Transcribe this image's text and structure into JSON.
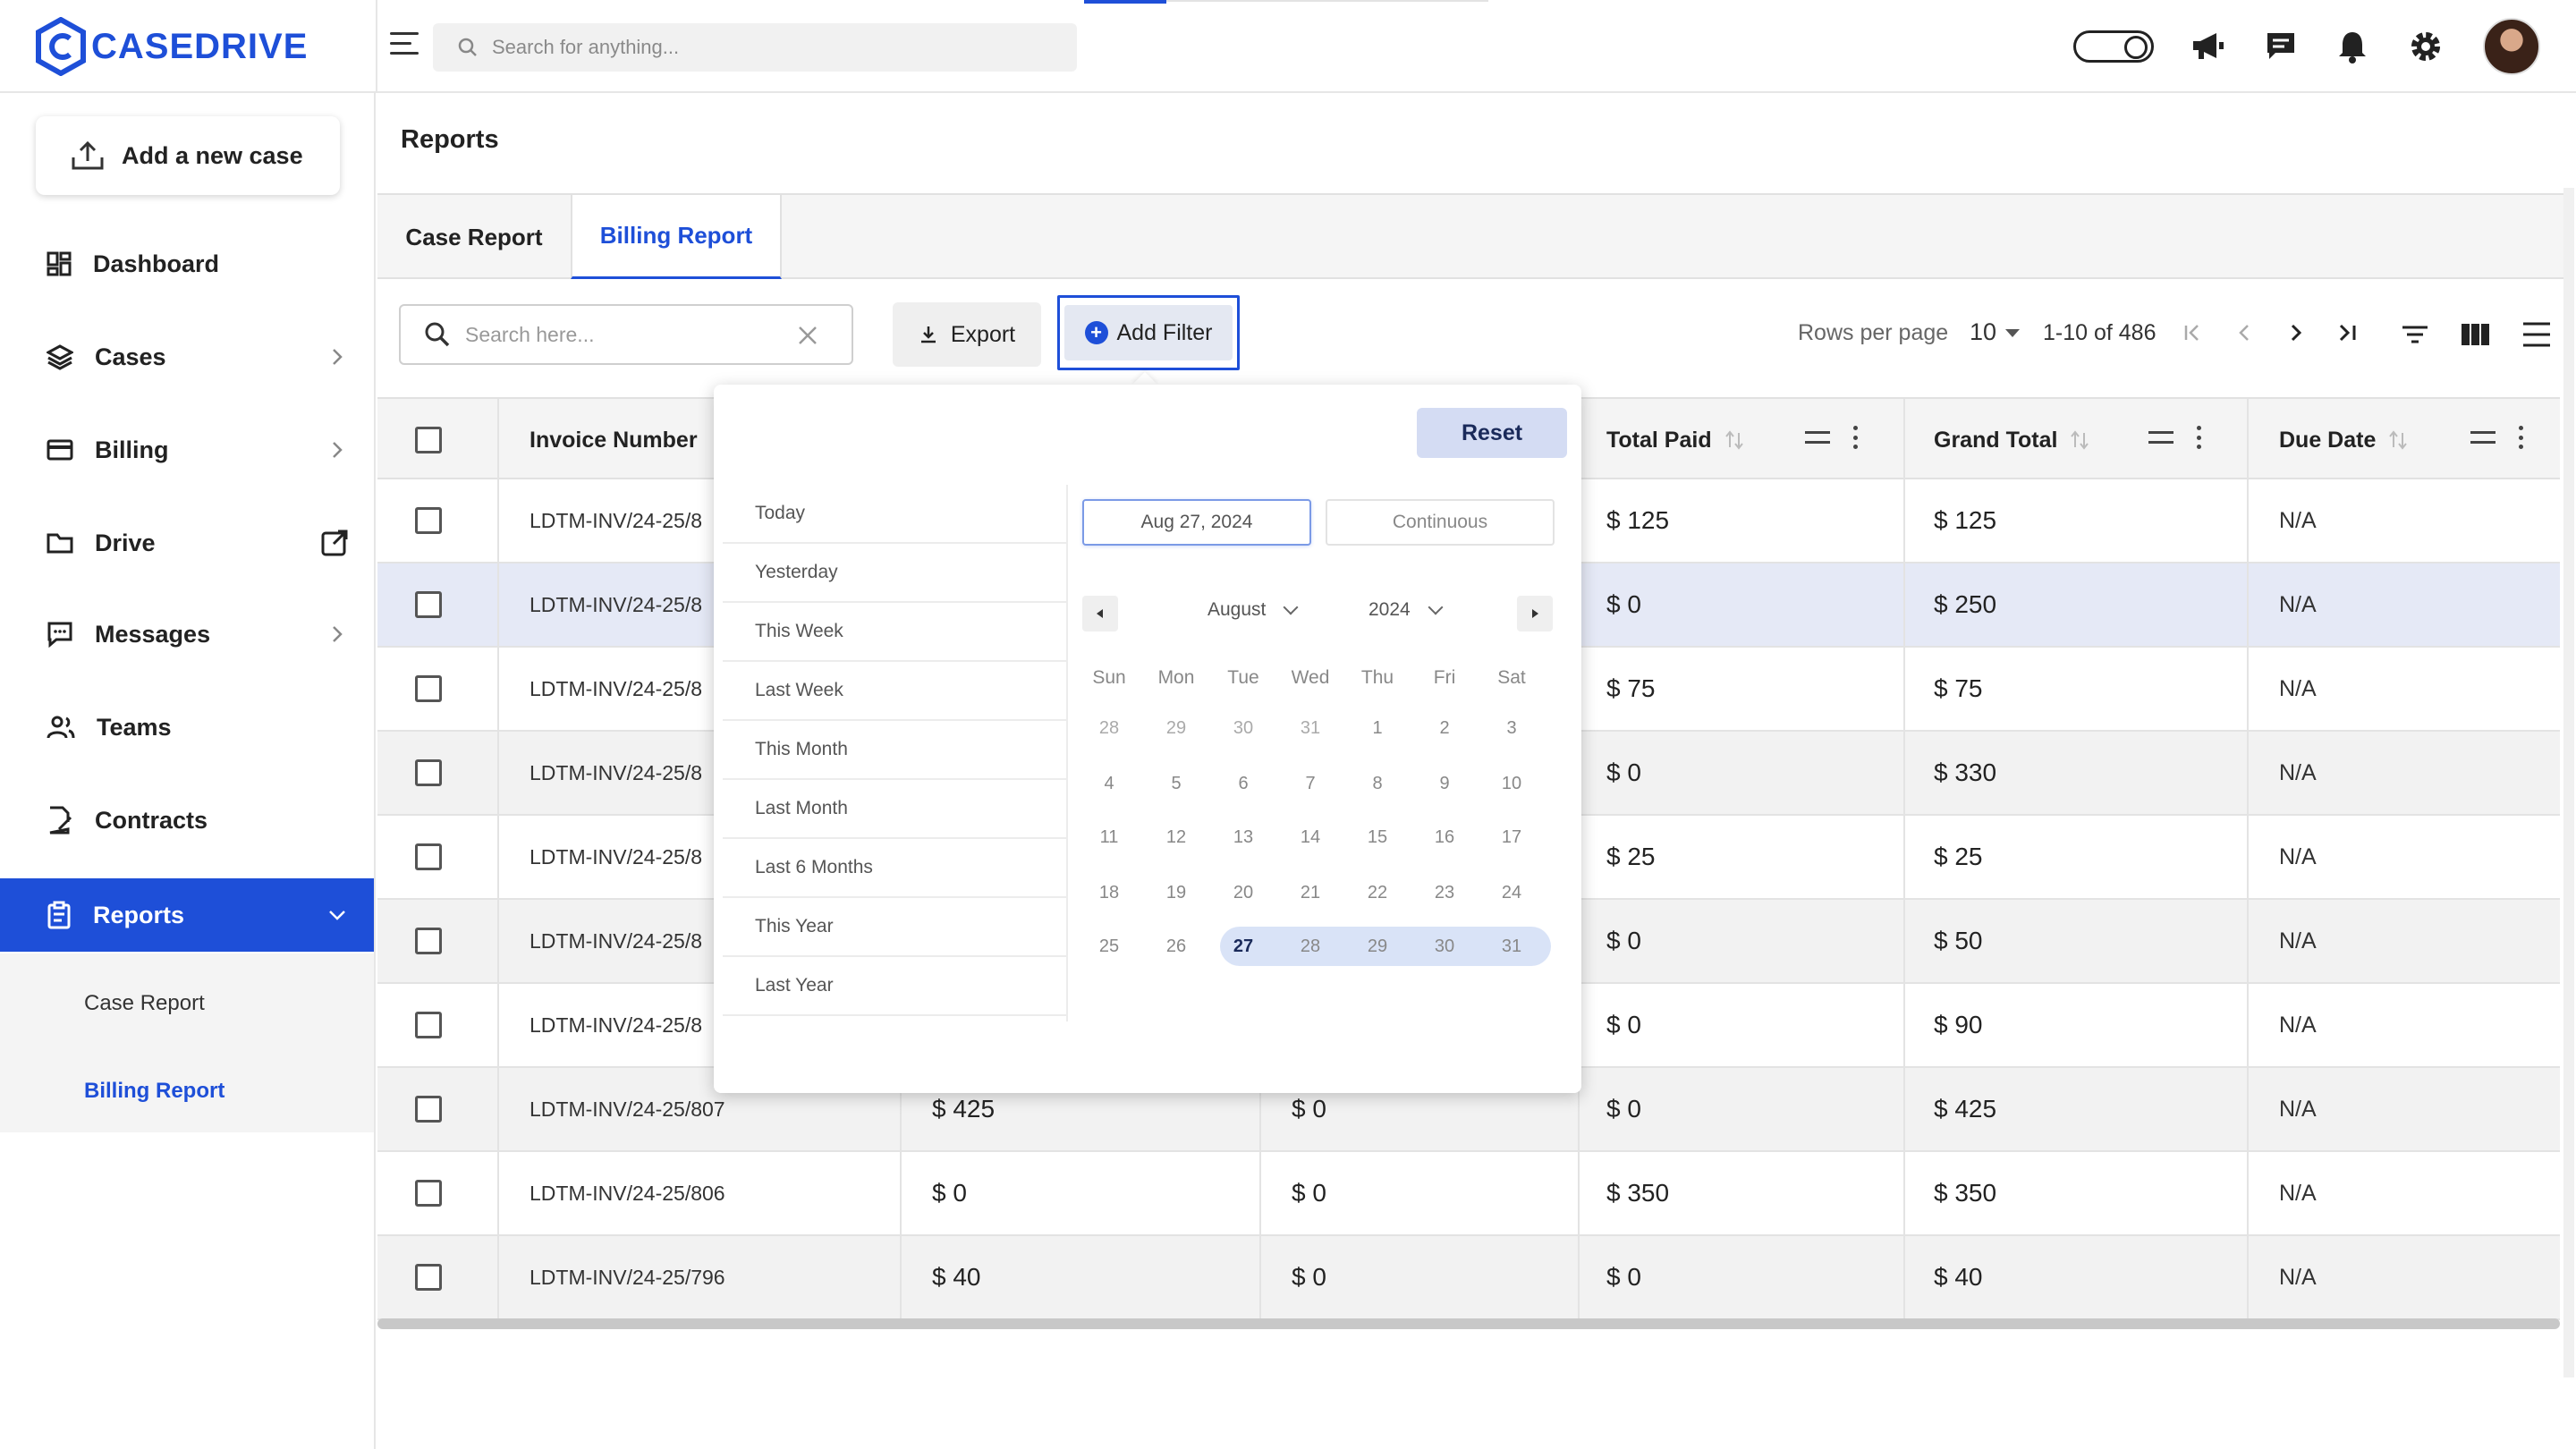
{
  "app": {
    "brand": "CASEDRIVE"
  },
  "header": {
    "search_placeholder": "Search for anything...",
    "icons": [
      "menu-icon",
      "search-icon",
      "theme-toggle",
      "megaphone-icon",
      "chat-icon",
      "bell-icon",
      "gear-icon",
      "avatar"
    ]
  },
  "sidebar": {
    "add_case_label": "Add a new case",
    "items": [
      {
        "label": "Dashboard",
        "icon": "dashboard-icon"
      },
      {
        "label": "Cases",
        "icon": "layers-icon"
      },
      {
        "label": "Billing",
        "icon": "card-icon"
      },
      {
        "label": "Drive",
        "icon": "folder-icon"
      },
      {
        "label": "Messages",
        "icon": "message-icon"
      },
      {
        "label": "Teams",
        "icon": "team-icon"
      },
      {
        "label": "Contracts",
        "icon": "contract-icon"
      },
      {
        "label": "Reports",
        "icon": "clipboard-icon"
      }
    ],
    "sub_items": [
      "Case Report",
      "Billing Report"
    ]
  },
  "page": {
    "title": "Reports",
    "tabs": [
      "Case Report",
      "Billing Report"
    ],
    "active_tab": "Billing Report"
  },
  "toolbar": {
    "search_placeholder": "Search here...",
    "export_label": "Export",
    "add_filter_label": "Add Filter",
    "rows_per_page_label": "Rows per page",
    "rows_per_page_value": "10",
    "range_text": "1-10 of 486"
  },
  "table": {
    "columns": [
      "Invoice Number",
      "Total Paid",
      "Grand Total",
      "Due Date"
    ],
    "rows": [
      {
        "invoice": "LDTM-INV/24-25/8",
        "c2": "",
        "c3": "",
        "paid": "$ 125",
        "grand": "$ 125",
        "due": "N/A"
      },
      {
        "invoice": "LDTM-INV/24-25/8",
        "c2": "",
        "c3": "",
        "paid": "$ 0",
        "grand": "$ 250",
        "due": "N/A"
      },
      {
        "invoice": "LDTM-INV/24-25/8",
        "c2": "",
        "c3": "",
        "paid": "$ 75",
        "grand": "$ 75",
        "due": "N/A"
      },
      {
        "invoice": "LDTM-INV/24-25/8",
        "c2": "",
        "c3": "",
        "paid": "$ 0",
        "grand": "$ 330",
        "due": "N/A"
      },
      {
        "invoice": "LDTM-INV/24-25/8",
        "c2": "",
        "c3": "",
        "paid": "$ 25",
        "grand": "$ 25",
        "due": "N/A"
      },
      {
        "invoice": "LDTM-INV/24-25/8",
        "c2": "",
        "c3": "",
        "paid": "$ 0",
        "grand": "$ 50",
        "due": "N/A"
      },
      {
        "invoice": "LDTM-INV/24-25/8",
        "c2": "",
        "c3": "",
        "paid": "$ 0",
        "grand": "$ 90",
        "due": "N/A"
      },
      {
        "invoice": "LDTM-INV/24-25/807",
        "c2": "$ 425",
        "c3": "$ 0",
        "paid": "$ 0",
        "grand": "$ 425",
        "due": "N/A"
      },
      {
        "invoice": "LDTM-INV/24-25/806",
        "c2": "$ 0",
        "c3": "$ 0",
        "paid": "$ 350",
        "grand": "$ 350",
        "due": "N/A"
      },
      {
        "invoice": "LDTM-INV/24-25/796",
        "c2": "$ 40",
        "c3": "$ 0",
        "paid": "$ 0",
        "grand": "$ 40",
        "due": "N/A"
      }
    ]
  },
  "filter_popover": {
    "reset_label": "Reset",
    "presets": [
      "Today",
      "Yesterday",
      "This Week",
      "Last Week",
      "This Month",
      "Last Month",
      "Last 6 Months",
      "This Year",
      "Last Year"
    ],
    "start_date": "Aug 27, 2024",
    "end_date_placeholder": "Continuous",
    "month": "August",
    "year": "2024",
    "weekdays": [
      "Sun",
      "Mon",
      "Tue",
      "Wed",
      "Thu",
      "Fri",
      "Sat"
    ],
    "weeks": [
      [
        "28",
        "29",
        "30",
        "31",
        "1",
        "2",
        "3"
      ],
      [
        "4",
        "5",
        "6",
        "7",
        "8",
        "9",
        "10"
      ],
      [
        "11",
        "12",
        "13",
        "14",
        "15",
        "16",
        "17"
      ],
      [
        "18",
        "19",
        "20",
        "21",
        "22",
        "23",
        "24"
      ],
      [
        "25",
        "26",
        "27",
        "28",
        "29",
        "30",
        "31"
      ]
    ],
    "selected_day": "27"
  },
  "colors": {
    "accent": "#1e4fd8",
    "selected_row": "#e5e9f6",
    "range_highlight": "#d9e3f7"
  }
}
